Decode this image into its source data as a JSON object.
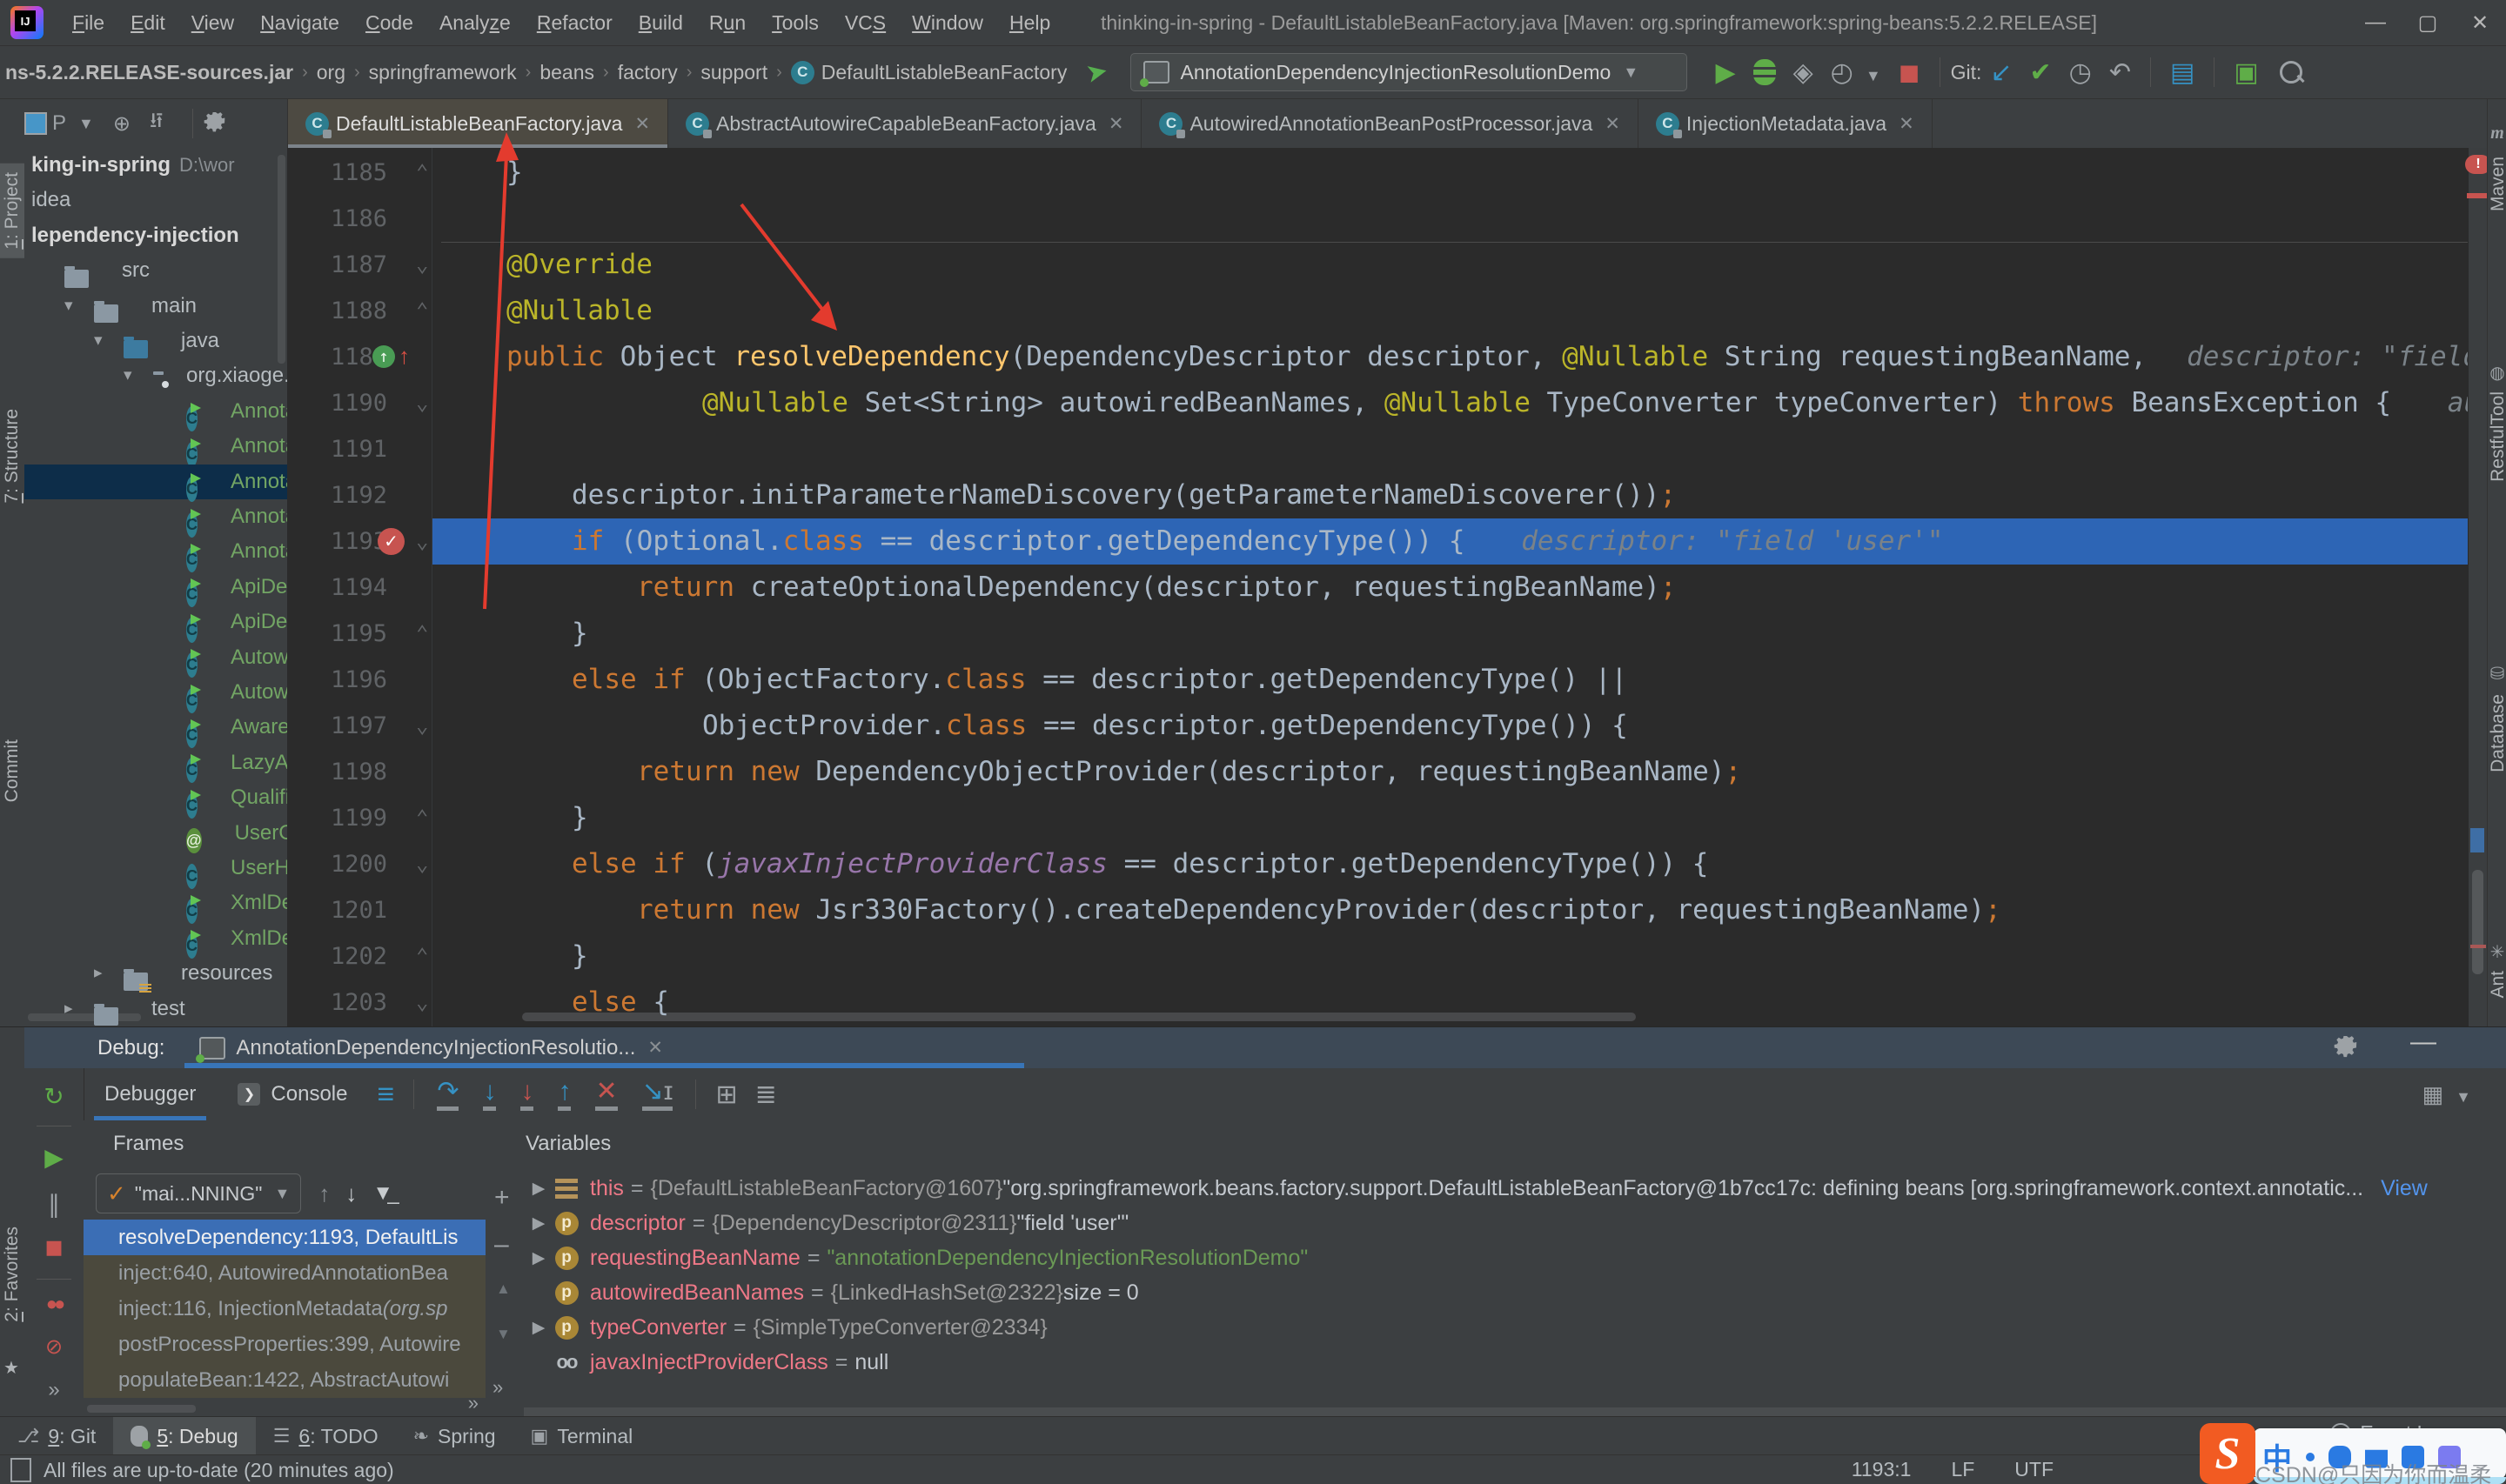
{
  "window": {
    "title": "thinking-in-spring - DefaultListableBeanFactory.java [Maven: org.springframework:spring-beans:5.2.2.RELEASE]",
    "menus": [
      {
        "pre": "",
        "mn": "F",
        "post": "ile"
      },
      {
        "pre": "",
        "mn": "E",
        "post": "dit"
      },
      {
        "pre": "",
        "mn": "V",
        "post": "iew"
      },
      {
        "pre": "",
        "mn": "N",
        "post": "avigate"
      },
      {
        "pre": "",
        "mn": "C",
        "post": "ode"
      },
      {
        "pre": "Analy",
        "mn": "z",
        "post": "e"
      },
      {
        "pre": "",
        "mn": "R",
        "post": "efactor"
      },
      {
        "pre": "",
        "mn": "B",
        "post": "uild"
      },
      {
        "pre": "R",
        "mn": "u",
        "post": "n"
      },
      {
        "pre": "",
        "mn": "T",
        "post": "ools"
      },
      {
        "pre": "VC",
        "mn": "S",
        "post": ""
      },
      {
        "pre": "",
        "mn": "W",
        "post": "indow"
      },
      {
        "pre": "",
        "mn": "H",
        "post": "elp"
      }
    ],
    "controls": {
      "minimize": "—",
      "maximize": "▢",
      "close": "✕"
    }
  },
  "toolbar": {
    "breadcrumbs": [
      "ns-5.2.2.RELEASE-sources.jar",
      "org",
      "springframework",
      "beans",
      "factory",
      "support"
    ],
    "breadcrumb_class": "DefaultListableBeanFactory",
    "run_config": "AnnotationDependencyInjectionResolutionDemo",
    "git_label": "Git:"
  },
  "tabs": [
    {
      "label": "DefaultListableBeanFactory.java",
      "active": true
    },
    {
      "label": "AbstractAutowireCapableBeanFactory.java",
      "active": false
    },
    {
      "label": "AutowiredAnnotationBeanPostProcessor.java",
      "active": false
    },
    {
      "label": "InjectionMetadata.java",
      "active": false
    }
  ],
  "left_stripe": {
    "project": {
      "num": "1",
      "label": "Project"
    },
    "structure": {
      "num": "7",
      "label": "Structure"
    },
    "commit": "Commit",
    "favorites": {
      "num": "2",
      "label": "Favorites"
    }
  },
  "right_stripe": {
    "maven": "Maven",
    "restful": "RestfulTool",
    "database": "Database",
    "ant": "Ant"
  },
  "project": {
    "items": [
      {
        "label": "king-in-spring",
        "suffix": " D:\\wor",
        "type": "none",
        "pad": 8,
        "bold": true
      },
      {
        "label": "idea",
        "type": "none",
        "pad": 8
      },
      {
        "label": "lependency-injection",
        "type": "none",
        "pad": 8,
        "bold": true
      },
      {
        "label": "src",
        "type": "folder",
        "pad": 46
      },
      {
        "label": "main",
        "type": "folder",
        "pad": 80,
        "chev": "▾"
      },
      {
        "label": "java",
        "type": "folder-blue",
        "pad": 114,
        "chev": "▾"
      },
      {
        "label": "org.xiaoge.t",
        "type": "package",
        "pad": 148,
        "chev": "▾"
      },
      {
        "label": "Annotatio",
        "type": "class-run",
        "pad": 186,
        "green": true
      },
      {
        "label": "Annotatio",
        "type": "class-run",
        "pad": 186,
        "green": true
      },
      {
        "label": "Annotatio",
        "type": "class-run",
        "pad": 186,
        "green": true,
        "selected": true
      },
      {
        "label": "Annotatio",
        "type": "class-run",
        "pad": 186,
        "green": true
      },
      {
        "label": "Annotatio",
        "type": "class-run",
        "pad": 186,
        "green": true
      },
      {
        "label": "ApiDepend",
        "type": "class-run",
        "pad": 186,
        "green": true
      },
      {
        "label": "ApiDepend",
        "type": "class-run",
        "pad": 186,
        "green": true
      },
      {
        "label": "Autowirin",
        "type": "class-run",
        "pad": 186,
        "green": true
      },
      {
        "label": "Autowirin",
        "type": "class-run",
        "pad": 186,
        "green": true
      },
      {
        "label": "AwareInte",
        "type": "class-run",
        "pad": 186,
        "green": true
      },
      {
        "label": "LazyAnnot",
        "type": "class-run",
        "pad": 186,
        "green": true
      },
      {
        "label": "Qualifier",
        "type": "class-run",
        "pad": 186,
        "green": true
      },
      {
        "label": "UserGroup",
        "type": "anno",
        "pad": 186,
        "green": true
      },
      {
        "label": "UserHolde",
        "type": "class",
        "pad": 186,
        "green": true
      },
      {
        "label": "XmlDepend",
        "type": "class-run",
        "pad": 186,
        "green": true
      },
      {
        "label": "XmlDepend",
        "type": "class-run",
        "pad": 186,
        "green": true
      },
      {
        "label": "resources",
        "type": "folder-res",
        "pad": 114,
        "chev": "▸"
      },
      {
        "label": "test",
        "type": "folder",
        "pad": 80,
        "chev": "▸"
      }
    ]
  },
  "editor": {
    "lines": [
      {
        "n": 1185,
        "ind": 1,
        "fold": "up",
        "toks": [
          [
            "d",
            "}"
          ]
        ]
      },
      {
        "n": 1186,
        "ind": 0,
        "toks": []
      },
      {
        "n": 1187,
        "ind": 1,
        "fold": "down",
        "sep": true,
        "toks": [
          [
            "a",
            "@Override"
          ]
        ]
      },
      {
        "n": 1188,
        "ind": 1,
        "fold": "up",
        "toks": [
          [
            "a",
            "@Nullable"
          ]
        ]
      },
      {
        "n": 1189,
        "ind": 1,
        "gutter": "override",
        "toks": [
          [
            "k",
            "public "
          ],
          [
            "d",
            "Object "
          ],
          [
            "m",
            "resolveDependency"
          ],
          [
            "d",
            "(DependencyDescriptor descriptor, "
          ],
          [
            "a",
            "@Nullable"
          ],
          [
            "d",
            " String requestingBeanName,"
          ]
        ],
        "hint": "descriptor: \"field 'user'\""
      },
      {
        "n": 1190,
        "ind": 4,
        "fold": "down",
        "toks": [
          [
            "a",
            "@Nullable"
          ],
          [
            "d",
            " Set<String> autowiredBeanNames, "
          ],
          [
            "a",
            "@Nullable"
          ],
          [
            "d",
            " TypeConverter typeConverter) "
          ],
          [
            "k",
            "throws"
          ],
          [
            "d",
            " BeansException { "
          ]
        ],
        "hint": "autowiredBeanNames:"
      },
      {
        "n": 1191,
        "ind": 0,
        "toks": []
      },
      {
        "n": 1192,
        "ind": 2,
        "toks": [
          [
            "d",
            "descriptor.initParameterNameDiscovery(getParameterNameDiscoverer())"
          ],
          [
            "k",
            ";"
          ]
        ]
      },
      {
        "n": 1193,
        "ind": 2,
        "fold": "down",
        "gutter": "breakpoint",
        "hl": true,
        "toks": [
          [
            "k",
            "if "
          ],
          [
            "d",
            "(Optional."
          ],
          [
            "k",
            "class"
          ],
          [
            "d",
            " == descriptor.getDependencyType()) { "
          ]
        ],
        "hint": "descriptor: \"field 'user'\""
      },
      {
        "n": 1194,
        "ind": 3,
        "toks": [
          [
            "k",
            "return "
          ],
          [
            "d",
            "createOptionalDependency(descriptor, requestingBeanName)"
          ],
          [
            "k",
            ";"
          ]
        ]
      },
      {
        "n": 1195,
        "ind": 2,
        "fold": "up",
        "toks": [
          [
            "d",
            "}"
          ]
        ]
      },
      {
        "n": 1196,
        "ind": 2,
        "toks": [
          [
            "k",
            "else if "
          ],
          [
            "d",
            "(ObjectFactory."
          ],
          [
            "k",
            "class"
          ],
          [
            "d",
            " == descriptor.getDependencyType() ||"
          ]
        ]
      },
      {
        "n": 1197,
        "ind": 4,
        "fold": "down",
        "toks": [
          [
            "d",
            "ObjectProvider."
          ],
          [
            "k",
            "class"
          ],
          [
            "d",
            " == descriptor.getDependencyType()) {"
          ]
        ]
      },
      {
        "n": 1198,
        "ind": 3,
        "toks": [
          [
            "k",
            "return new "
          ],
          [
            "d",
            "DependencyObjectProvider(descriptor, requestingBeanName)"
          ],
          [
            "k",
            ";"
          ]
        ]
      },
      {
        "n": 1199,
        "ind": 2,
        "fold": "up",
        "toks": [
          [
            "d",
            "}"
          ]
        ]
      },
      {
        "n": 1200,
        "ind": 2,
        "fold": "down",
        "toks": [
          [
            "k",
            "else if "
          ],
          [
            "d",
            "("
          ],
          [
            "f",
            "javaxInjectProviderClass"
          ],
          [
            "d",
            " == descriptor.getDependencyType()) {"
          ]
        ]
      },
      {
        "n": 1201,
        "ind": 3,
        "toks": [
          [
            "k",
            "return new "
          ],
          [
            "d",
            "Jsr330Factory().createDependencyProvider(descriptor, requestingBeanName)"
          ],
          [
            "k",
            ";"
          ]
        ]
      },
      {
        "n": 1202,
        "ind": 2,
        "fold": "up",
        "toks": [
          [
            "d",
            "}"
          ]
        ]
      },
      {
        "n": 1203,
        "ind": 2,
        "fold": "down",
        "toks": [
          [
            "k",
            "else"
          ],
          [
            "d",
            " {"
          ]
        ]
      }
    ]
  },
  "debug": {
    "label": "Debug:",
    "session_tab": "AnnotationDependencyInjectionResolutio...",
    "tabs": {
      "debugger": "Debugger",
      "console": "Console"
    },
    "frames_title": "Frames",
    "variables_title": "Variables",
    "thread_dropdown": "\"mai...NNING\"",
    "frames": [
      {
        "text": "resolveDependency:1193, DefaultLis",
        "sel": true
      },
      {
        "text": "inject:640, AutowiredAnnotationBea",
        "lib": true
      },
      {
        "text": "inject:116, InjectionMetadata ",
        "italic": "(org.sp",
        "lib": true
      },
      {
        "text": "postProcessProperties:399, Autowire",
        "lib": true
      },
      {
        "text": "populateBean:1422, AbstractAutowi",
        "lib": true
      }
    ],
    "variables": [
      {
        "arrow": true,
        "icon": "bars",
        "name": "this",
        "parts": [
          [
            "ref",
            "{DefaultListableBeanFactory@1607} "
          ],
          [
            "val",
            "\"org.springframework.beans.factory.support.DefaultListableBeanFactory@1b7cc17c: defining beans [org.springframework.context.annotatic..."
          ]
        ],
        "link": "View"
      },
      {
        "arrow": true,
        "icon": "p",
        "name": "descriptor",
        "parts": [
          [
            "ref",
            "{DependencyDescriptor@2311} "
          ],
          [
            "val",
            "\"field 'user'\""
          ]
        ]
      },
      {
        "arrow": true,
        "icon": "p",
        "name": "requestingBeanName",
        "parts": [
          [
            "str",
            "\"annotationDependencyInjectionResolutionDemo\""
          ]
        ]
      },
      {
        "arrow": false,
        "icon": "p",
        "name": "autowiredBeanNames",
        "parts": [
          [
            "ref",
            "{LinkedHashSet@2322} "
          ],
          [
            "val",
            " size = 0"
          ]
        ]
      },
      {
        "arrow": true,
        "icon": "p",
        "name": "typeConverter",
        "parts": [
          [
            "ref",
            "{SimpleTypeConverter@2334}"
          ]
        ]
      },
      {
        "arrow": false,
        "icon": "oo",
        "name": "javaxInjectProviderClass",
        "parts": [
          [
            "val",
            "null"
          ]
        ]
      }
    ]
  },
  "bottom_bar": {
    "items": [
      {
        "num": "9",
        "label": "Git",
        "icon": "git"
      },
      {
        "num": "5",
        "label": "Debug",
        "icon": "bug",
        "active": true
      },
      {
        "num": "6",
        "label": "TODO",
        "icon": "todo"
      },
      {
        "num": "",
        "label": "Spring",
        "icon": "spring"
      },
      {
        "num": "",
        "label": "Terminal",
        "icon": "terminal"
      }
    ],
    "event_log": "Event Log"
  },
  "status_bar": {
    "message": "All files are up-to-date (20 minutes ago)",
    "caret": "1193:1",
    "line_ending": "LF",
    "encoding": "UTF",
    "ime_char": "中",
    "watermark": "CSDN@只因为你而温柔"
  }
}
